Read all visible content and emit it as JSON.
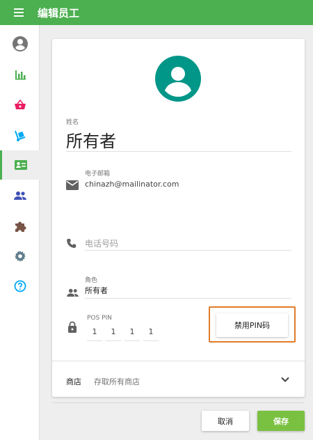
{
  "header": {
    "title": "编辑员工",
    "menu_icon": "menu-icon"
  },
  "sidebar": {
    "items": [
      {
        "name": "account",
        "icon": "account-circle-icon",
        "color": "#757575"
      },
      {
        "name": "reports",
        "icon": "bar-chart-icon",
        "color": "#4caf50"
      },
      {
        "name": "sales",
        "icon": "basket-icon",
        "color": "#e91e63"
      },
      {
        "name": "items",
        "icon": "hand-truck-icon",
        "color": "#03a9f4"
      },
      {
        "name": "employees",
        "icon": "badge-icon",
        "color": "#4caf50",
        "active": true
      },
      {
        "name": "customers",
        "icon": "people-icon",
        "color": "#3f51b5"
      },
      {
        "name": "apps",
        "icon": "puzzle-icon",
        "color": "#795548"
      },
      {
        "name": "settings",
        "icon": "gear-icon",
        "color": "#607d8b"
      },
      {
        "name": "help",
        "icon": "help-icon",
        "color": "#03a9f4"
      }
    ]
  },
  "form": {
    "avatar_color": "#009688",
    "name": {
      "label": "姓名",
      "value": "所有者"
    },
    "email": {
      "label": "电子邮箱",
      "value": "chinazh@mailinator.com"
    },
    "phone": {
      "placeholder": "电话号码"
    },
    "role": {
      "label": "角色",
      "value": "所有者"
    },
    "pos_pin": {
      "label": "POS PIN",
      "digits": [
        "1",
        "1",
        "1",
        "1"
      ]
    },
    "disable_pin_button": "禁用PIN码",
    "store": {
      "label": "商店",
      "value": "存取所有商店"
    }
  },
  "footer": {
    "cancel": "取消",
    "save": "保存"
  },
  "colors": {
    "accent": "#4caf50",
    "save": "#7ac142",
    "highlight": "#e07b2a"
  }
}
